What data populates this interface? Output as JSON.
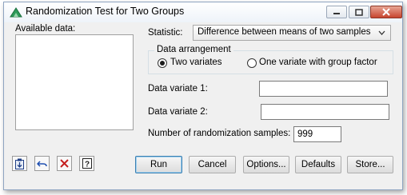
{
  "window": {
    "title": "Randomization Test for Two Groups"
  },
  "available_data": {
    "label": "Available data:",
    "items": []
  },
  "statistic": {
    "label": "Statistic:",
    "value": "Difference between means of two samples"
  },
  "data_arrangement": {
    "legend": "Data arrangement",
    "options": [
      {
        "label": "Two variates",
        "selected": true
      },
      {
        "label": "One variate with group factor",
        "selected": false
      }
    ]
  },
  "data_variate_1": {
    "label": "Data variate 1:",
    "value": ""
  },
  "data_variate_2": {
    "label": "Data variate 2:",
    "value": ""
  },
  "samples": {
    "label": "Number of randomization samples:",
    "value": "999"
  },
  "buttons": {
    "run": "Run",
    "cancel": "Cancel",
    "options": "Options...",
    "defaults": "Defaults",
    "store": "Store..."
  },
  "toolbar_icons": [
    "clipboard-icon",
    "undo-icon",
    "clear-icon",
    "help-icon"
  ],
  "colors": {
    "window_bg": "#f0f0f0",
    "close_button": "#c7452e",
    "primary_border": "#3c7fb1"
  }
}
